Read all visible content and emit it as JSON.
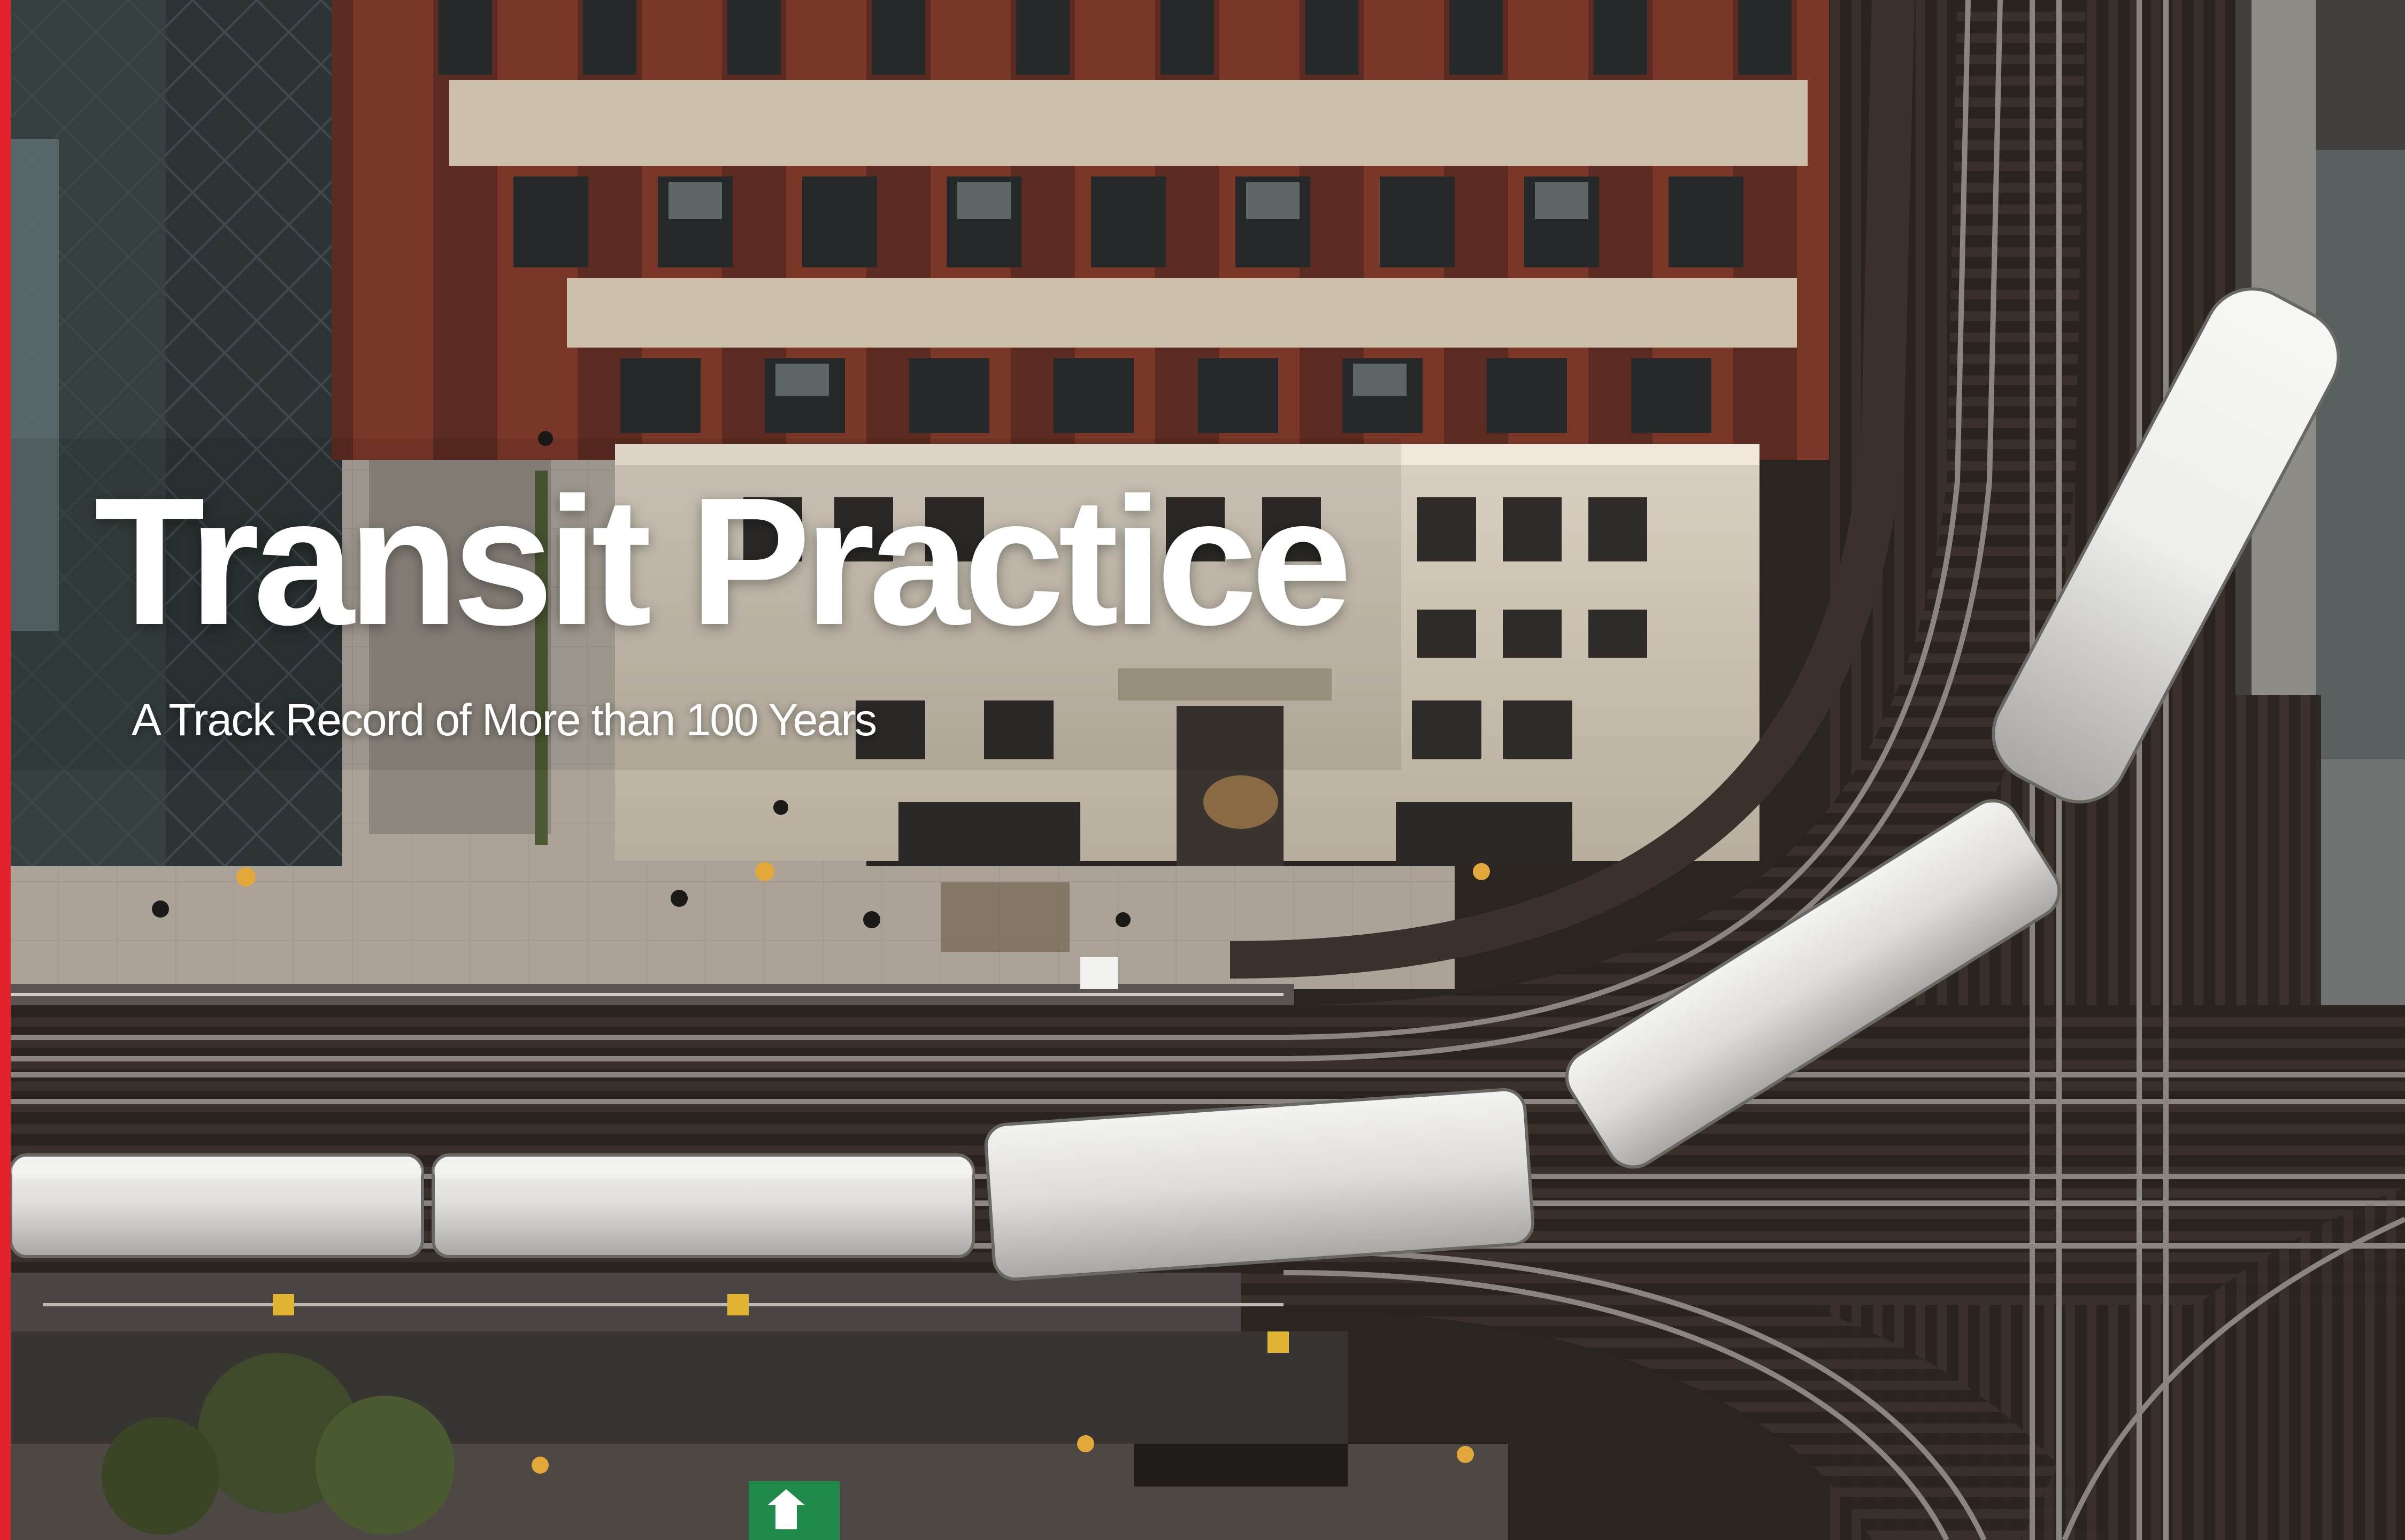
{
  "hero": {
    "title": "Transit Practice",
    "subtitle": "A Track Record of More than 100 Years"
  },
  "colors": {
    "accent": "#e4202a",
    "text": "#ffffff",
    "brick": "#6e3024",
    "stone": "#cfc6b6",
    "plaza": "#9a938a",
    "track_bed": "#3a302b",
    "rail": "#8a8580",
    "train": "#e4e3e0"
  },
  "icons": {
    "sign": "exit-arrow-icon"
  }
}
